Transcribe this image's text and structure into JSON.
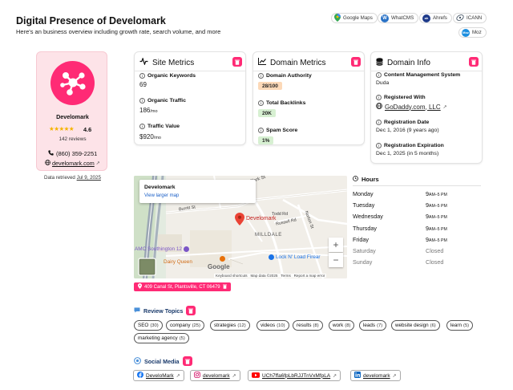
{
  "header": {
    "title": "Digital Presence of Develomark",
    "subtitle": "Here's an business overview including growth rate, search volume, and more"
  },
  "sources": [
    {
      "label": "Google Maps",
      "icon": "google-maps-icon",
      "color": "#e94235"
    },
    {
      "label": "WhatCMS",
      "icon": "whatcms-icon",
      "color": "#2a72c6"
    },
    {
      "label": "Ahrefs",
      "icon": "ahrefs-icon",
      "color": "#1e3a8a"
    },
    {
      "label": "ICANN",
      "icon": "icann-icon",
      "color": "#4a5a6a"
    },
    {
      "label": "Moz",
      "icon": "moz-icon",
      "color": "#1d8fe0"
    }
  ],
  "profile": {
    "name": "Develomark",
    "stars": "★★★★★",
    "rating": "4.6",
    "reviews": "142 reviews",
    "phone": "(860) 359-2251",
    "website": "develomark.com",
    "retrieved_prefix": "Data retrieved",
    "retrieved_date": "Jul 9, 2025"
  },
  "site_metrics": {
    "title": "Site Metrics",
    "organic_keywords_label": "Organic Keywords",
    "organic_keywords": "69",
    "organic_traffic_label": "Organic Traffic",
    "organic_traffic": "186",
    "organic_traffic_unit": "/mo",
    "traffic_value_label": "Traffic Value",
    "traffic_value": "$920",
    "traffic_value_unit": "/mo"
  },
  "domain_metrics": {
    "title": "Domain Metrics",
    "authority_label": "Domain Authority",
    "authority": "28/100",
    "backlinks_label": "Total Backlinks",
    "backlinks": "20K",
    "spam_label": "Spam Score",
    "spam": "1%"
  },
  "domain_info": {
    "title": "Domain Info",
    "cms_label": "Content Management System",
    "cms": "Duda",
    "registered_label": "Registered With",
    "registrar": "GoDaddy.com, LLC",
    "reg_date_label": "Registration Date",
    "reg_date": "Dec 1, 2016 (9 years ago)",
    "exp_label": "Registration Expiration",
    "exp_date": "Dec 1, 2025 (in 5 months)"
  },
  "map": {
    "place_name": "Develomark",
    "larger_link": "View larger map",
    "pin_label": "Develomark",
    "town_label": "MILLDALE",
    "road_clark": "Clark St",
    "road_burritt": "Burritt St",
    "road_todd": "Todd Rd",
    "road_russell": "Russell Rd",
    "road_norton": "Norton St",
    "place_amc": "AMC Southington 12",
    "place_dq": "Dairy Queen",
    "place_lock": "Lock N' Load Firear",
    "route_322": "322",
    "google": "Google",
    "keyboard": "Keyboard shortcuts",
    "map_data": "Map data ©2025",
    "terms": "Terms",
    "report": "Report a map error",
    "zoom_in": "+",
    "zoom_out": "−"
  },
  "address": "409 Canal St, Plantsville, CT 06479",
  "hours": {
    "title": "Hours",
    "days": [
      {
        "day": "Monday",
        "time": "9",
        "range": "AM–5 PM",
        "closed": false
      },
      {
        "day": "Tuesday",
        "time": "9",
        "range": "AM–5 PM",
        "closed": false
      },
      {
        "day": "Wednesday",
        "time": "9",
        "range": "AM–5 PM",
        "closed": false
      },
      {
        "day": "Thursday",
        "time": "9",
        "range": "AM–5 PM",
        "closed": false
      },
      {
        "day": "Friday",
        "time": "9",
        "range": "AM–5 PM",
        "closed": false
      },
      {
        "day": "Saturday",
        "time": "Closed",
        "range": "",
        "closed": true
      },
      {
        "day": "Sunday",
        "time": "Closed",
        "range": "",
        "closed": true
      }
    ]
  },
  "review_topics": {
    "title": "Review Topics",
    "items": [
      {
        "label": "SEO",
        "count": "(30)"
      },
      {
        "label": "company",
        "count": "(25)"
      },
      {
        "label": "strategies",
        "count": "(12)"
      },
      {
        "label": "videos",
        "count": "(10)"
      },
      {
        "label": "results",
        "count": "(8)"
      },
      {
        "label": "work",
        "count": "(8)"
      },
      {
        "label": "leads",
        "count": "(7)"
      },
      {
        "label": "website design",
        "count": "(6)"
      },
      {
        "label": "learn",
        "count": "(5)"
      },
      {
        "label": "marketing agency",
        "count": "(5)"
      }
    ]
  },
  "social": {
    "title": "Social Media",
    "items": [
      {
        "label": "DeveloMark",
        "icon": "facebook-icon",
        "color": "#1877f2"
      },
      {
        "label": "develomark",
        "icon": "instagram-icon",
        "color": "#d62976"
      },
      {
        "label": "UCh7ffa6fpLbRJJTnVxMfpLA",
        "icon": "youtube-icon",
        "color": "#ff0000"
      },
      {
        "label": "develomark",
        "icon": "linkedin-icon",
        "color": "#0a66c2"
      }
    ]
  },
  "colors": {
    "accent": "#ff2a75",
    "authority_badge": "#fcd9b8",
    "backlinks_badge": "#d7f0d2",
    "spam_badge": "#d7f0d2",
    "profile_bg": "#fde3e8"
  }
}
